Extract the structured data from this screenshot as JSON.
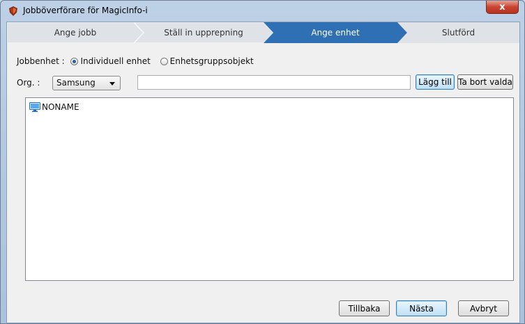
{
  "window": {
    "title": "Jobböverförare för MagicInfo-i",
    "close_glyph": "x"
  },
  "steps": [
    {
      "label": "Ange jobb",
      "active": false
    },
    {
      "label": "Ställ in upprepning",
      "active": false
    },
    {
      "label": "Ange enhet",
      "active": true
    },
    {
      "label": "Slutförd",
      "active": false
    }
  ],
  "job_unit": {
    "label": "Jobbenhet :",
    "options": [
      {
        "label": "Individuell enhet",
        "selected": true
      },
      {
        "label": "Enhetsgruppsobjekt",
        "selected": false
      }
    ]
  },
  "org": {
    "label": "Org. :",
    "selected": "Samsung"
  },
  "search": {
    "value": "",
    "placeholder": ""
  },
  "buttons": {
    "add": "Lägg till",
    "remove_selected": "Ta bort valda",
    "back": "Tillbaka",
    "next": "Nästa",
    "cancel": "Avbryt"
  },
  "devices": [
    {
      "name": "NONAME",
      "icon": "monitor-icon"
    }
  ],
  "colors": {
    "active_step": "#2f6fb3",
    "inactive_step": "#dfe3e8",
    "title_bar": "#b8cce4"
  }
}
